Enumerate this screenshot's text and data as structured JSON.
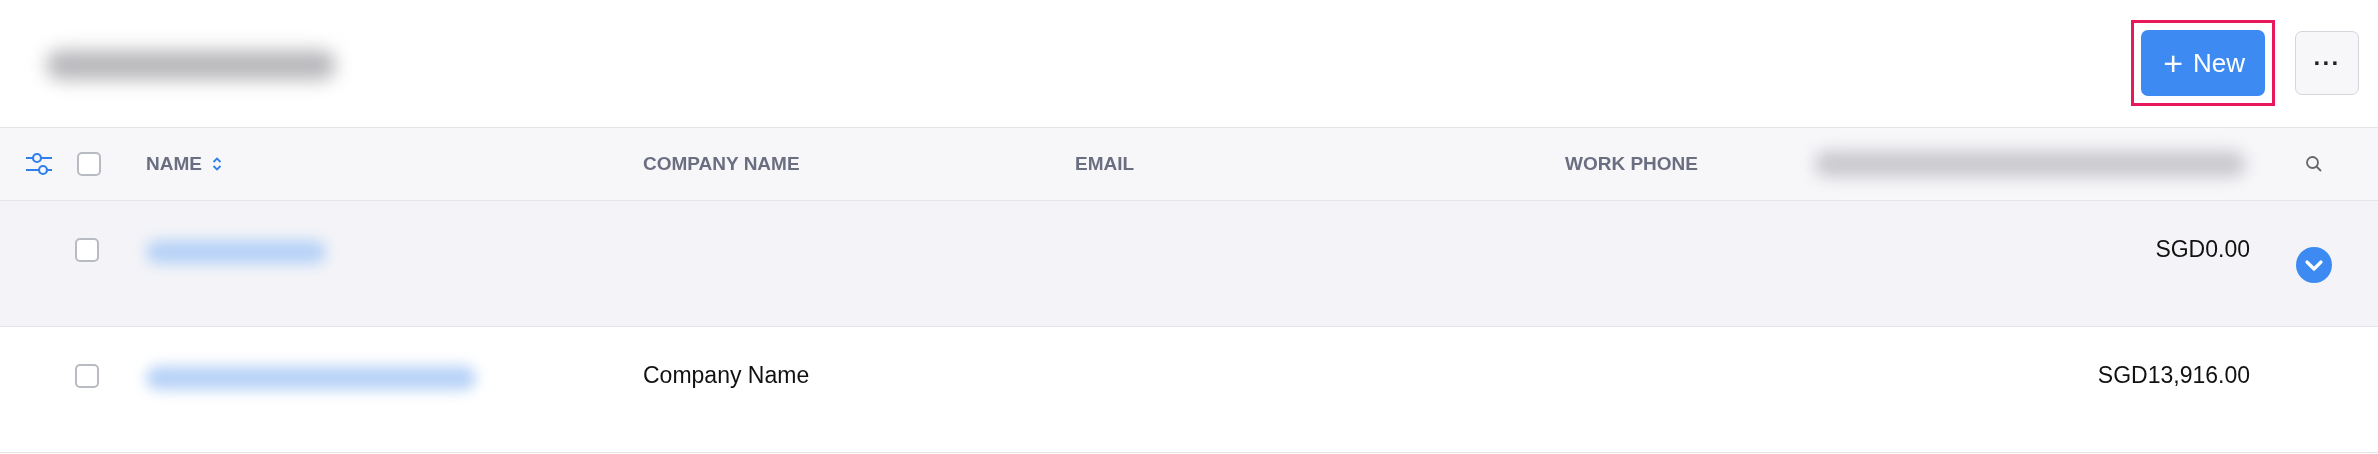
{
  "header": {
    "new_button": {
      "label": "New",
      "icon": "+",
      "highlighted": true
    },
    "more_button": {
      "label": "···"
    }
  },
  "table": {
    "columns": [
      {
        "label": "NAME",
        "sortable": true
      },
      {
        "label": "COMPANY NAME",
        "sortable": false
      },
      {
        "label": "EMAIL",
        "sortable": false
      },
      {
        "label": "WORK PHONE",
        "sortable": false
      }
    ],
    "header_checkbox": {
      "checked": false
    },
    "rows": [
      {
        "company_name": "",
        "email": "",
        "work_phone": "",
        "amount": "SGD0.00",
        "checked": false,
        "hovered": true
      },
      {
        "company_name": "Company Name",
        "email": "",
        "work_phone": "",
        "amount": "SGD13,916.00",
        "checked": false,
        "hovered": false
      }
    ]
  }
}
